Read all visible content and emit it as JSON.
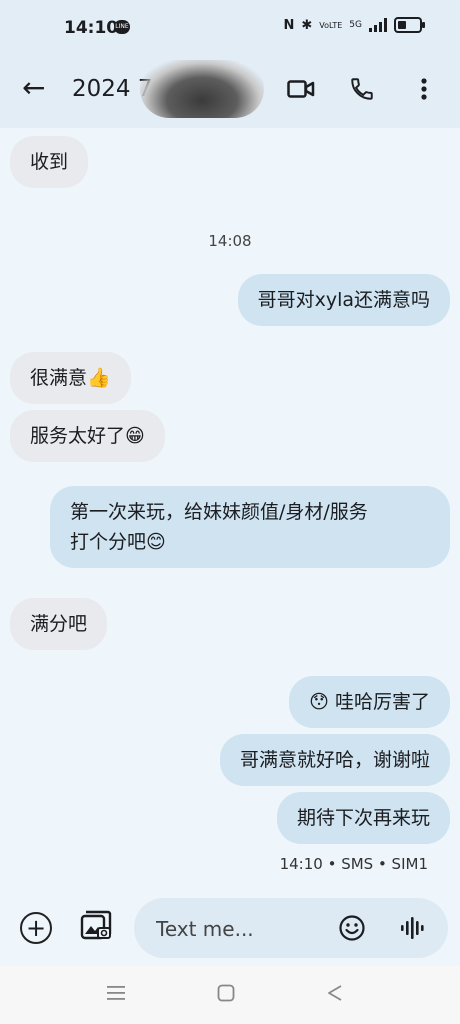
{
  "status_bar": {
    "time": "14:10",
    "line_icon": "LINE",
    "nfc": "N",
    "bluetooth": "✱",
    "volte": "VoLTE",
    "network": "5G",
    "battery_level": 0.4
  },
  "app_bar": {
    "title": "2024 7",
    "back_icon": "arrow-left-icon",
    "video_icon": "video-call-icon",
    "phone_icon": "phone-icon",
    "more_icon": "more-vert-icon"
  },
  "messages": [
    {
      "dir": "in",
      "text": "收到"
    },
    {
      "type": "time",
      "text": "14:08"
    },
    {
      "dir": "out",
      "text": "哥哥对xyla还满意吗"
    },
    {
      "dir": "in",
      "text": "很满意👍"
    },
    {
      "dir": "in",
      "text": "服务太好了😁"
    },
    {
      "dir": "out",
      "text": "第一次来玩，给妹妹颜值/身材/服务\n打个分吧😊"
    },
    {
      "dir": "in",
      "text": "满分吧"
    },
    {
      "dir": "out",
      "text": "😯 哇哈厉害了"
    },
    {
      "dir": "out",
      "text": "哥满意就好哈，谢谢啦"
    },
    {
      "dir": "out",
      "text": "期待下次再来玩"
    }
  ],
  "message_meta": "14:10 • SMS • SIM1",
  "composer": {
    "placeholder": "Text me...",
    "add_icon": "add-circle-icon",
    "gallery_icon": "gallery-icon",
    "emoji_icon": "emoji-icon",
    "voice_icon": "voice-icon"
  },
  "nav_bar": {
    "menu_icon": "menu-icon",
    "home_icon": "home-icon",
    "back_icon": "back-triangle-icon"
  }
}
